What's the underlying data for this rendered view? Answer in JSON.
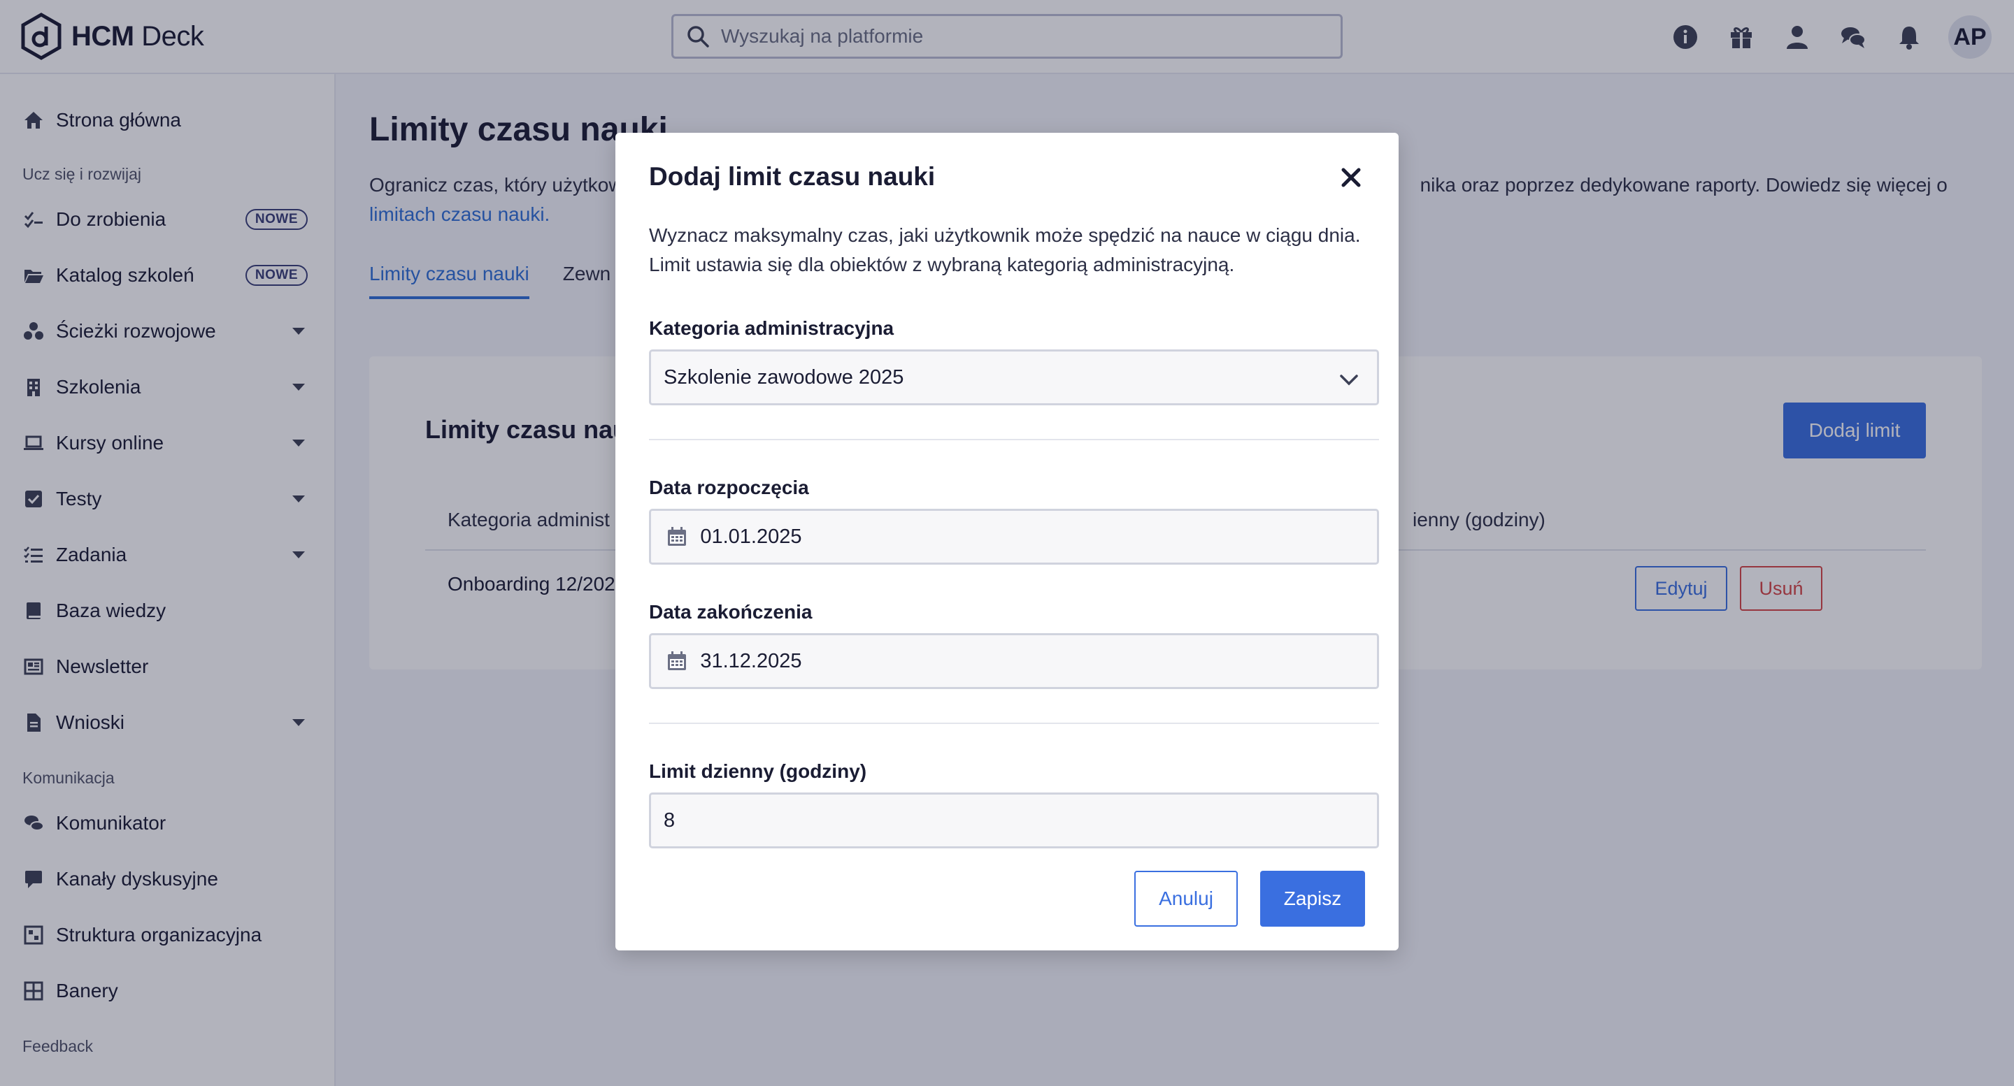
{
  "app": {
    "name_bold": "HCM",
    "name_rest": " Deck",
    "avatar": "AP"
  },
  "search": {
    "placeholder": "Wyszukaj na platformie"
  },
  "header_icons": [
    "info-icon",
    "gift-icon",
    "user-icon",
    "chat-icon",
    "bell-icon"
  ],
  "sidebar": {
    "items": [
      {
        "label": "Strona główna",
        "icon": "home-icon"
      },
      {
        "label": "Do zrobienia",
        "icon": "checklist-icon",
        "badge": "NOWE"
      },
      {
        "label": "Katalog szkoleń",
        "icon": "folder-icon",
        "badge": "NOWE"
      },
      {
        "label": "Ścieżki rozwojowe",
        "icon": "paths-icon",
        "expandable": true
      },
      {
        "label": "Szkolenia",
        "icon": "building-icon",
        "expandable": true
      },
      {
        "label": "Kursy online",
        "icon": "laptop-icon",
        "expandable": true
      },
      {
        "label": "Testy",
        "icon": "checkbox-icon",
        "expandable": true
      },
      {
        "label": "Zadania",
        "icon": "tasks-icon",
        "expandable": true
      },
      {
        "label": "Baza wiedzy",
        "icon": "book-icon"
      },
      {
        "label": "Newsletter",
        "icon": "newspaper-icon"
      },
      {
        "label": "Wnioski",
        "icon": "file-icon",
        "expandable": true
      },
      {
        "label": "Komunikator",
        "icon": "comments-icon"
      },
      {
        "label": "Kanały dyskusyjne",
        "icon": "message-icon"
      },
      {
        "label": "Struktura organizacyjna",
        "icon": "org-icon"
      },
      {
        "label": "Banery",
        "icon": "grid-icon"
      }
    ],
    "sections": [
      "Ucz się i rozwijaj",
      "Komunikacja",
      "Feedback"
    ]
  },
  "page": {
    "title": "Limity czasu nauki",
    "desc_start": "Ogranicz czas, który użytkow",
    "desc_end": "nika oraz poprzez dedykowane raporty. Dowiedz się więcej o",
    "desc_link": "limitach czasu nauki.",
    "tabs": [
      "Limity czasu nauki",
      "Zewn"
    ]
  },
  "card": {
    "title": "Limity czasu nau",
    "add_button": "Dodaj limit",
    "col_category": "Kategoria administ",
    "col_limit": "ienny (godziny)",
    "row_category": "Onboarding 12/202",
    "edit_button": "Edytuj",
    "delete_button": "Usuń"
  },
  "modal": {
    "title": "Dodaj limit czasu nauki",
    "description_line1": "Wyznacz maksymalny czas, jaki użytkownik może spędzić na nauce w ciągu dnia.",
    "description_line2": "Limit ustawia się dla obiektów z wybraną kategorią administracyjną.",
    "category_label": "Kategoria administracyjna",
    "category_value": "Szkolenie zawodowe 2025",
    "start_label": "Data rozpoczęcia",
    "start_value": "01.01.2025",
    "end_label": "Data zakończenia",
    "end_value": "31.12.2025",
    "limit_label": "Limit dzienny (godziny)",
    "limit_value": "8",
    "cancel_button": "Anuluj",
    "save_button": "Zapisz"
  },
  "colors": {
    "accent": "#3a6fe0",
    "danger": "#d64545",
    "text": "#1a1c33",
    "badge": "#3a3f78"
  }
}
